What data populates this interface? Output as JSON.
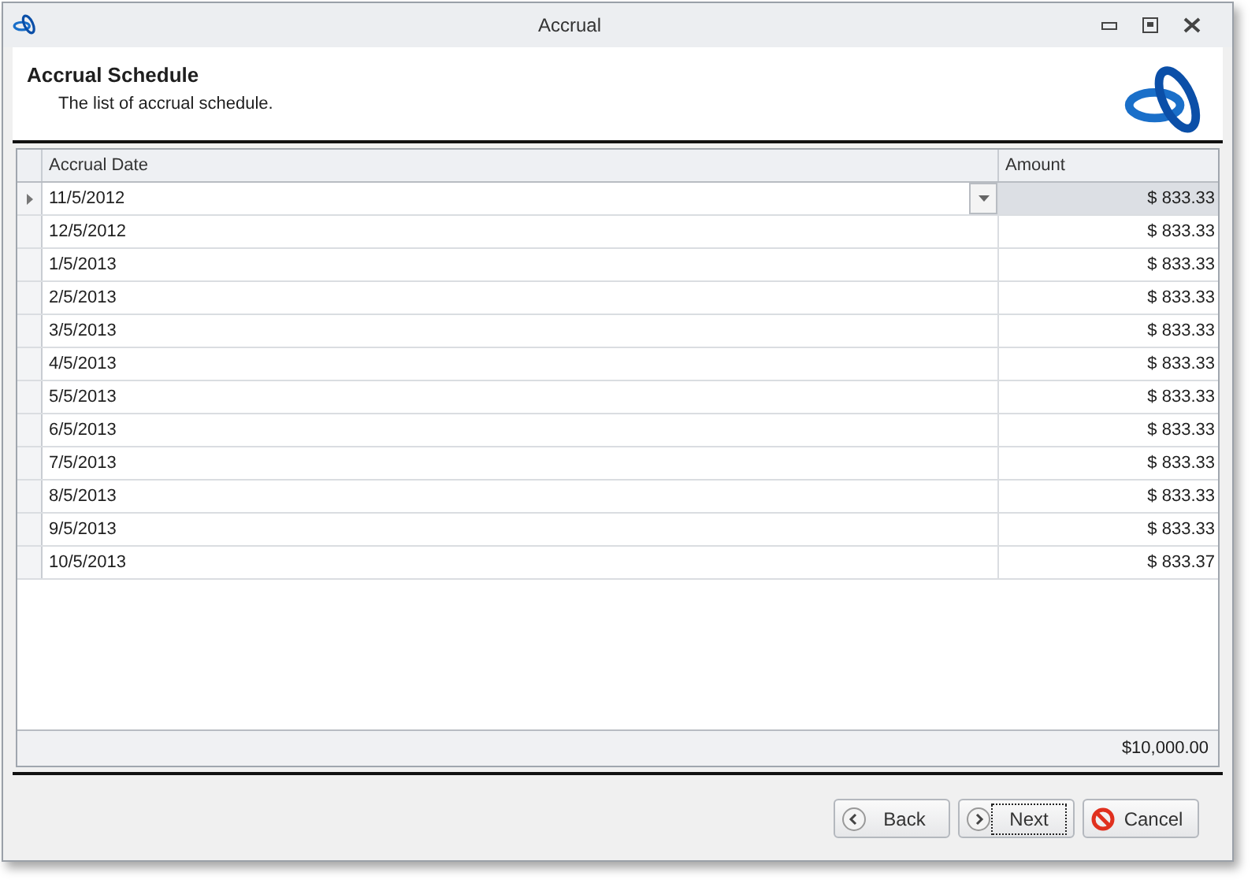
{
  "window": {
    "title": "Accrual"
  },
  "header": {
    "title": "Accrual Schedule",
    "subtitle": "The list of accrual schedule."
  },
  "table": {
    "columns": [
      "Accrual Date",
      "Amount"
    ],
    "rows": [
      {
        "date": "11/5/2012",
        "amount": "$ 833.33",
        "selected": true
      },
      {
        "date": "12/5/2012",
        "amount": "$ 833.33",
        "selected": false
      },
      {
        "date": "1/5/2013",
        "amount": "$ 833.33",
        "selected": false
      },
      {
        "date": "2/5/2013",
        "amount": "$ 833.33",
        "selected": false
      },
      {
        "date": "3/5/2013",
        "amount": "$ 833.33",
        "selected": false
      },
      {
        "date": "4/5/2013",
        "amount": "$ 833.33",
        "selected": false
      },
      {
        "date": "5/5/2013",
        "amount": "$ 833.33",
        "selected": false
      },
      {
        "date": "6/5/2013",
        "amount": "$ 833.33",
        "selected": false
      },
      {
        "date": "7/5/2013",
        "amount": "$ 833.33",
        "selected": false
      },
      {
        "date": "8/5/2013",
        "amount": "$ 833.33",
        "selected": false
      },
      {
        "date": "9/5/2013",
        "amount": "$ 833.33",
        "selected": false
      },
      {
        "date": "10/5/2013",
        "amount": "$ 833.37",
        "selected": false
      }
    ],
    "total": "$10,000.00"
  },
  "buttons": [
    {
      "kind": "back",
      "label": "Back",
      "focused": false
    },
    {
      "kind": "next",
      "label": "Next",
      "focused": true
    },
    {
      "kind": "cancel",
      "label": "Cancel",
      "focused": false
    }
  ]
}
